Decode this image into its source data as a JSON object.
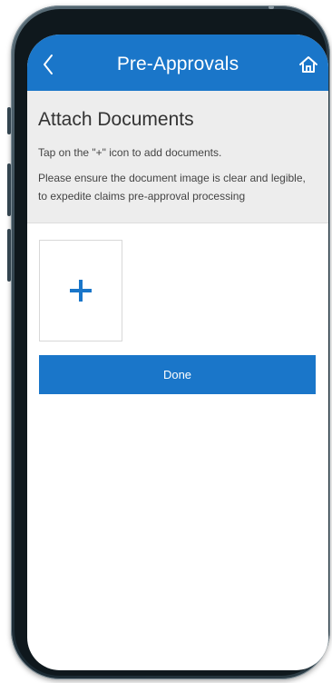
{
  "header": {
    "title": "Pre-Approvals",
    "back_icon": "chevron-left-icon",
    "home_icon": "home-icon"
  },
  "info": {
    "title": "Attach Documents",
    "instruction_1": "Tap on the \"+\" icon to add documents.",
    "instruction_2": "Please ensure the document image is clear and legible, to expedite claims pre-approval processing"
  },
  "attachments": {
    "add_icon": "plus-icon"
  },
  "actions": {
    "done_label": "Done"
  },
  "colors": {
    "primary": "#1a76c9",
    "panel_background": "#ededed",
    "text": "#333333"
  }
}
